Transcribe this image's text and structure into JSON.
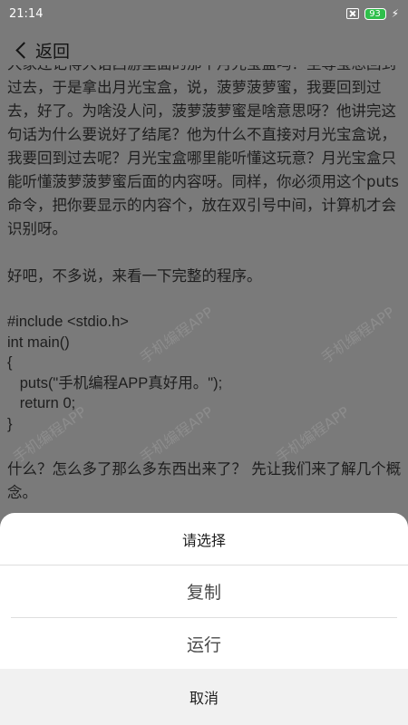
{
  "status": {
    "time": "21:14",
    "battery": "93"
  },
  "nav": {
    "back_label": "返回"
  },
  "article": {
    "paragraph1": "大家还记得大话西游里面的那个月光宝盒吗？至尊宝想回到过去，于是拿出月光宝盒，说，菠萝菠萝蜜，我要回到过去，好了。为啥没人问，菠萝菠萝蜜是啥意思呀？他讲完这句话为什么要说好了结尾？他为什么不直接对月光宝盒说，我要回到过去呢？月光宝盒哪里能听懂这玩意？月光宝盒只能听懂菠萝菠萝蜜后面的内容呀。同样，你必须用这个puts命令，把你要显示的内容个，放在双引号中间，计算机才会识别呀。",
    "paragraph2": "好吧，不多说，来看一下完整的程序。",
    "code": "#include <stdio.h>\nint main()\n{\n   puts(\"手机编程APP真好用。\");\n   return 0;\n}",
    "paragraph3": "什么？怎么多了那么多东西出来了？ 先让我们来了解几个概念。",
    "watermark": "手机编程APP"
  },
  "sheet": {
    "title": "请选择",
    "options": [
      "复制",
      "运行"
    ],
    "cancel": "取消"
  }
}
